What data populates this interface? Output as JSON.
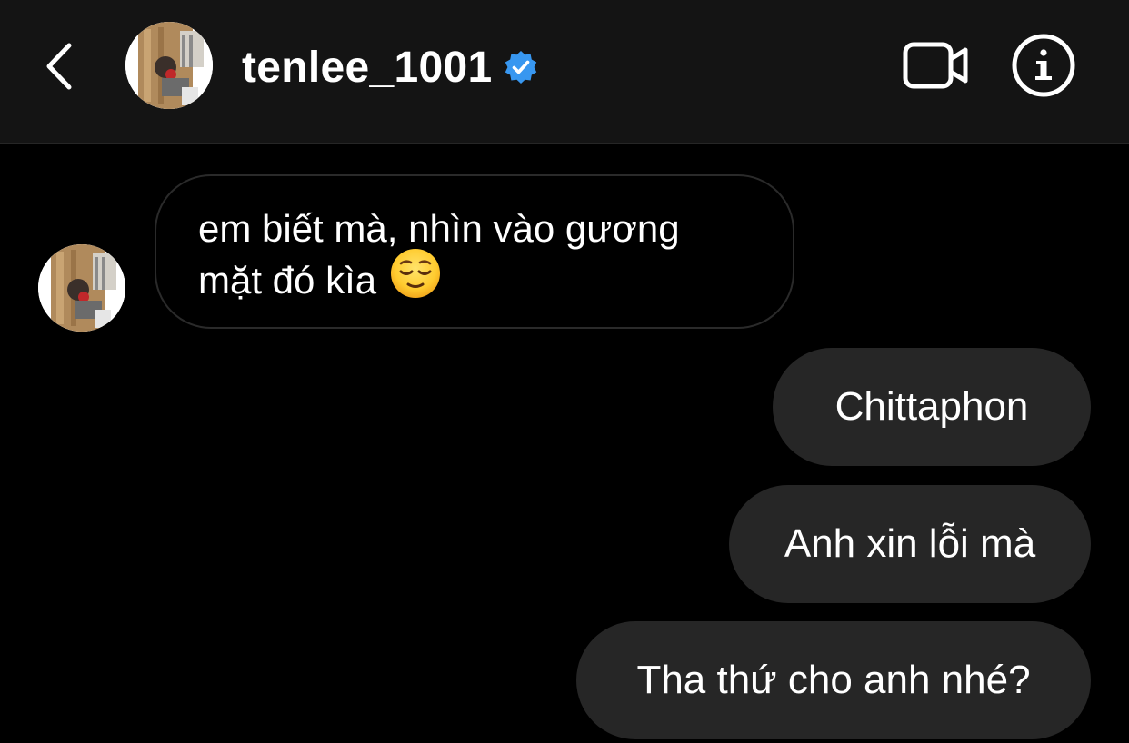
{
  "header": {
    "username": "tenlee_1001",
    "verified_icon": "verified-badge-icon",
    "back_icon": "chevron-left-icon",
    "video_call_icon": "video-camera-icon",
    "info_icon": "info-circle-icon"
  },
  "messages": [
    {
      "direction": "incoming",
      "lines": [
        "em biết mà, nhìn vào gương",
        "mặt đó kìa"
      ],
      "emoji": "relieved-face-emoji"
    },
    {
      "direction": "outgoing",
      "text": "Chittaphon"
    },
    {
      "direction": "outgoing",
      "text": "Anh xin lỗi mà"
    },
    {
      "direction": "outgoing",
      "text": "Tha thứ cho anh nhé?"
    }
  ],
  "colors": {
    "header_bg": "#141414",
    "page_bg": "#000000",
    "outgoing_bubble": "#262626",
    "verified_blue": "#3897f0"
  }
}
